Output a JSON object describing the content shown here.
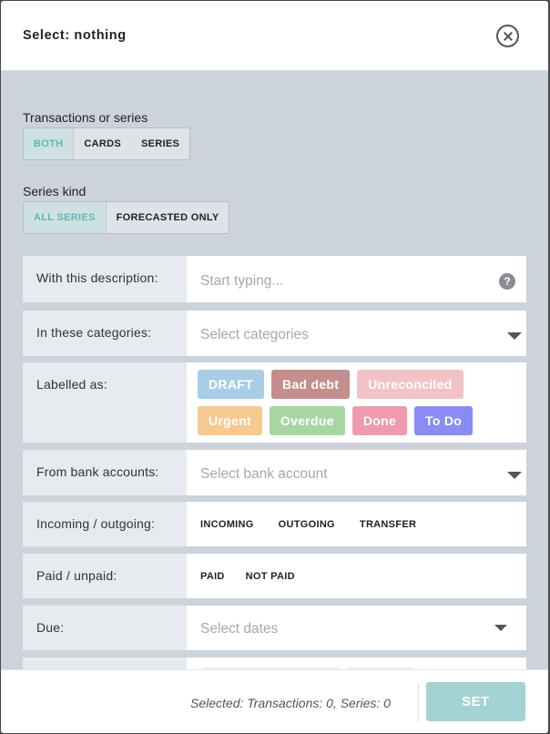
{
  "header": {
    "title": "Select: nothing"
  },
  "tx_series": {
    "label": "Transactions or series",
    "options": [
      "BOTH",
      "CARDS",
      "SERIES"
    ],
    "active": "BOTH"
  },
  "series_kind": {
    "label": "Series kind",
    "options": [
      "ALL SERIES",
      "FORECASTED ONLY"
    ],
    "active": "ALL SERIES"
  },
  "rows": {
    "description": {
      "label": "With this description:",
      "placeholder": "Start typing..."
    },
    "categories": {
      "label": "In these categories:",
      "placeholder": "Select categories"
    },
    "labels": {
      "label": "Labelled as:",
      "chips": [
        {
          "text": "DRAFT",
          "color": "#a9cde6"
        },
        {
          "text": "Bad debt",
          "color": "#c58d8d"
        },
        {
          "text": "Unreconciled",
          "color": "#f2c3c6"
        },
        {
          "text": "Urgent",
          "color": "#f7c990"
        },
        {
          "text": "Overdue",
          "color": "#a7d6a4"
        },
        {
          "text": "Done",
          "color": "#ee9aaf"
        },
        {
          "text": "To Do",
          "color": "#8a8bf3"
        }
      ]
    },
    "bank": {
      "label": "From bank accounts:",
      "placeholder": "Select bank account"
    },
    "direction": {
      "label": "Incoming / outgoing:",
      "options": [
        "INCOMING",
        "OUTGOING",
        "TRANSFER"
      ]
    },
    "paid": {
      "label": "Paid / unpaid:",
      "options": [
        "PAID",
        "NOT PAID"
      ]
    },
    "due": {
      "label": "Due:",
      "placeholder": "Select dates"
    }
  },
  "footer": {
    "status": "Selected: Transactions: 0,  Series: 0",
    "set_label": "SET"
  },
  "colors": {
    "accent": "#5fb8b8",
    "set_button": "#a3d3d3",
    "modal_bg": "#ccd3db"
  }
}
